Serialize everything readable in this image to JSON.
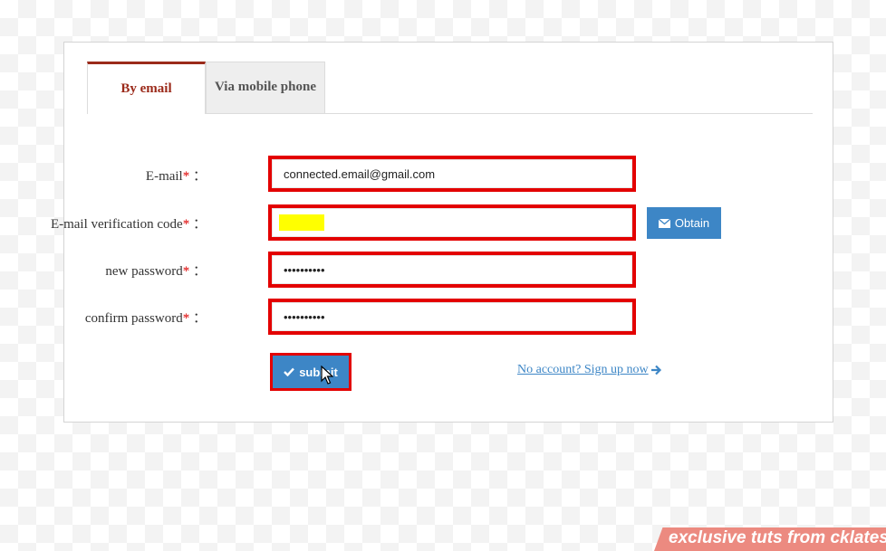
{
  "tabs": [
    {
      "label": "By email",
      "active": true
    },
    {
      "label": "Via mobile phone",
      "active": false
    }
  ],
  "form": {
    "email": {
      "label": "E-mail",
      "required_mark": "*",
      "colon": "：",
      "value": "connected.email@gmail.com"
    },
    "code": {
      "label": "E-mail verification code",
      "required_mark": "*",
      "colon": "：",
      "value": ""
    },
    "new_password": {
      "label": "new password",
      "required_mark": "*",
      "colon": "：",
      "value": "••••••••••"
    },
    "confirm_password": {
      "label": "confirm password",
      "required_mark": "*",
      "colon": "：",
      "value": "••••••••••"
    }
  },
  "buttons": {
    "obtain": "Obtain",
    "submit": "submit"
  },
  "signup_link": "No account? Sign up now",
  "watermark": "exclusive tuts from cklatest",
  "colors": {
    "accent": "#3d86c6",
    "active_tab": "#9b2a1a",
    "highlight_border": "#e30000",
    "required": "#dd0000"
  }
}
